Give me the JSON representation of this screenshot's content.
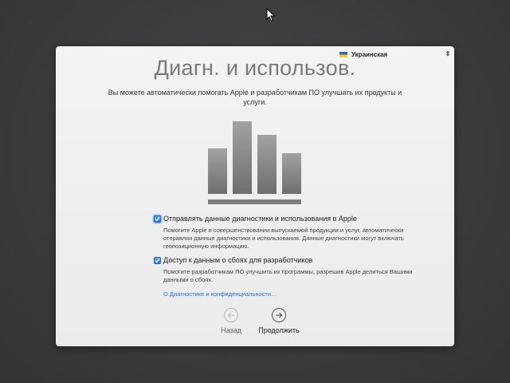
{
  "window": {
    "title": "Диагн. и использов.",
    "subtitle": "Вы можете автоматически помогать Apple и разработчикам ПО улучшать их продукты и услуги."
  },
  "language_selector": {
    "value": "Украинская",
    "flag_icon": "ukraine-flag-icon",
    "colors": {
      "flag_top": "#2f63c8",
      "flag_bottom": "#f1d12a"
    }
  },
  "hero_icon": "bar-chart-icon",
  "options": [
    {
      "label": "Отправлять данные диагностики и использования в Apple",
      "checked": true,
      "description": "Помогите Apple в совершенствовании выпускаемой продукции и услуг, автоматически отправляя данные диагностики и использования. Данные диагностики могут включать геопозиционную информацию."
    },
    {
      "label": "Доступ к данным о сбоях для разработчиков",
      "checked": true,
      "description": "Помогите разработчикам ПО улучшить их программы, разрешив Apple делиться Вашими данными о сбоях."
    }
  ],
  "privacy_link": "О Диагностике и конфиденциальности…",
  "navigation": {
    "back_label": "Назад",
    "back_enabled": false,
    "next_label": "Продолжить",
    "next_enabled": true
  },
  "colors": {
    "checkbox": "#2b79e2",
    "link": "#2a6fd3",
    "title": "#7a7a7a"
  }
}
